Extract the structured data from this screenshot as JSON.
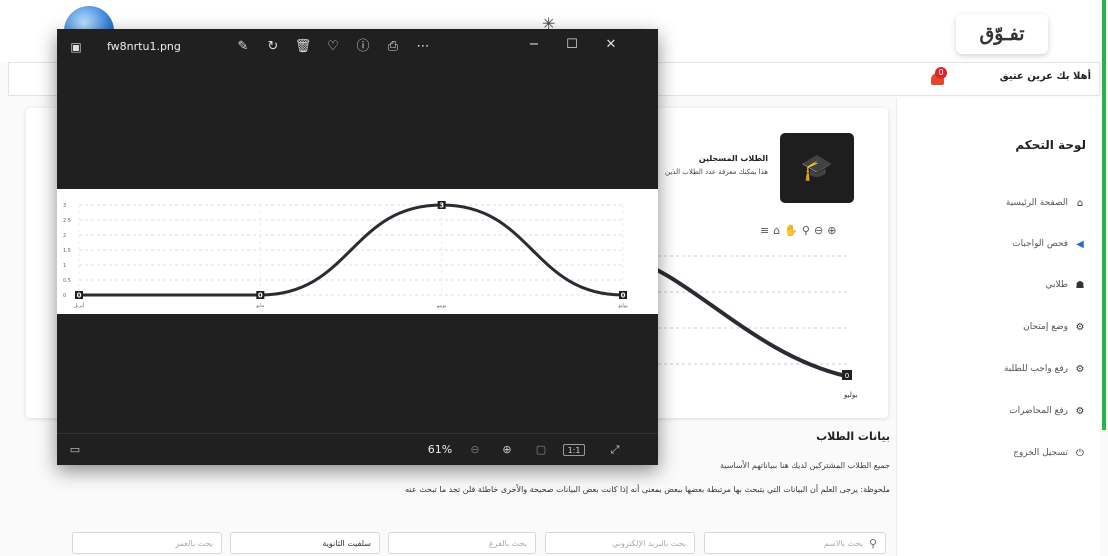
{
  "site": {
    "logo_text": "تفـوّق",
    "welcome_text": "أهلا بك عرين عتيق",
    "notification_count": "0"
  },
  "sidebar": {
    "title": "لوحة التحكم",
    "items": [
      {
        "label": "الصفحة الرئيسية",
        "icon": "home-icon"
      },
      {
        "label": "فحص الواجبات",
        "icon": "megaphone-icon"
      },
      {
        "label": "طلابي",
        "icon": "graduate-icon"
      },
      {
        "label": "وضع إمتحان",
        "icon": "gear-icon"
      },
      {
        "label": "رفع واجب للطلبة",
        "icon": "gear-icon"
      },
      {
        "label": "رفع المحاضرات",
        "icon": "gear-icon"
      },
      {
        "label": "تسجيل الخروج",
        "icon": "power-icon"
      }
    ]
  },
  "registered_card": {
    "title": "الطلاب المسجلين",
    "description": "هذا يمكنك معرفة عدد الطلاب الذين"
  },
  "chart_data": {
    "type": "line",
    "categories": [
      "أبريل",
      "مايو",
      "يونيو",
      "يوليو"
    ],
    "values": [
      0,
      0,
      3,
      0
    ],
    "y_ticks": [
      "3",
      "2.5",
      "2",
      "1.5",
      "1",
      "0.5",
      "0"
    ],
    "ylim": [
      0,
      3
    ],
    "grid": true,
    "line_color": "#2b2b33",
    "background_visible_label": "يوليو"
  },
  "students_section": {
    "title": "بيانات الطلاب",
    "subtitle": "جميع الطلاب المشتركين لديك هنا ببياناتهم الأساسية",
    "note": "ملحوظة: يرجى العلم أن البيانات التي يتبحث بها مرتبطة بعضها ببعض بمعنى أنه إذا كانت بعض البيانات صحيحة والأخرى خاطئة فلن تجد ما تبحث عنه",
    "filters": {
      "name_placeholder": "بحث بالاسم",
      "email_placeholder": "بحث بالبريد الإلكتروني",
      "branch_placeholder": "بحث بالفرع",
      "school_value": "سلفيت الثانوية",
      "age_placeholder": "بحث بالعمر"
    }
  },
  "viewer": {
    "filename": "fw8nrtu1.png",
    "zoom": "61%",
    "actual_size_label": "1:1"
  },
  "colors": {
    "accent_green": "#2ab24b",
    "viewer_bg": "#202020",
    "badge_red": "#e0252a"
  }
}
